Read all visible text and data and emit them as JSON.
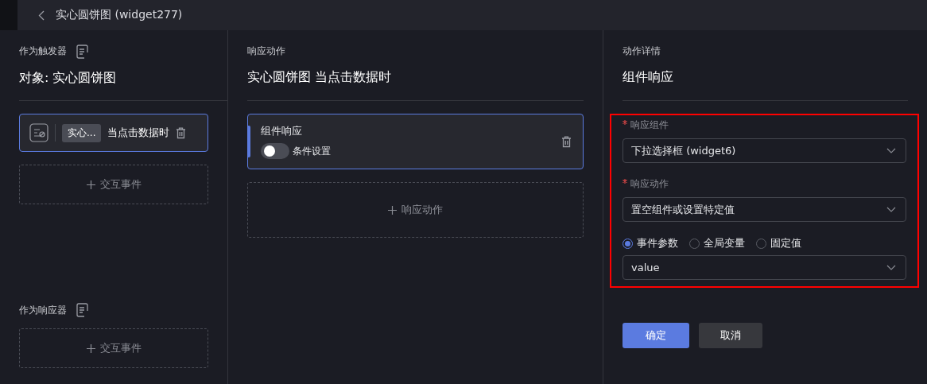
{
  "header": {
    "title": "实心圆饼图 (widget277)"
  },
  "trigger": {
    "label": "作为触发器",
    "title": "对象: 实心圆饼图",
    "events": [
      {
        "tag": "实心...",
        "text": "当点击数据时",
        "selected": true
      }
    ],
    "add_label": "交互事件"
  },
  "responder": {
    "label": "作为响应器",
    "add_label": "交互事件"
  },
  "actions": {
    "label": "响应动作",
    "title": "实心圆饼图 当点击数据时",
    "items": [
      {
        "name": "组件响应",
        "toggle_label": "条件设置",
        "on": false,
        "selected": true
      }
    ],
    "add_label": "响应动作"
  },
  "details": {
    "label": "动作详情",
    "title": "组件响应",
    "highlighted": true,
    "fields": [
      {
        "label": "响应组件",
        "required": true,
        "value": "下拉选择框 (widget6)"
      },
      {
        "label": "响应动作",
        "required": true,
        "value": "置空组件或设置特定值"
      }
    ],
    "radios": [
      {
        "label": "事件参数",
        "selected": true
      },
      {
        "label": "全局变量",
        "selected": false
      },
      {
        "label": "固定值",
        "selected": false
      }
    ],
    "param_value": "value",
    "buttons": [
      {
        "label": "确定",
        "kind": "primary"
      },
      {
        "label": "取消",
        "kind": "secondary"
      }
    ]
  }
}
